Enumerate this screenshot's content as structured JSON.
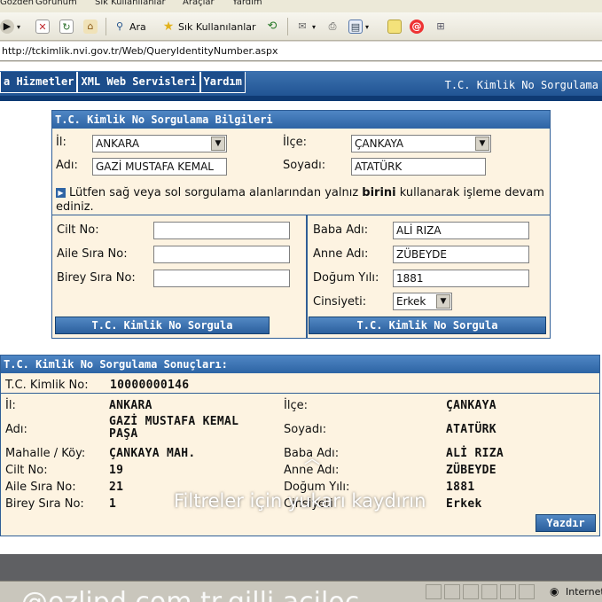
{
  "browser": {
    "menu": [
      "Gözden",
      "Görünüm",
      "Sık Kullanılanlar",
      "Araçlar",
      "Yardım"
    ],
    "search_label": "Ara",
    "favorites_label": "Sık Kullanılanlar",
    "address": "http://tckimlik.nvi.gov.tr/Web/QueryIdentityNumber.aspx",
    "status_internet": "Internet"
  },
  "nav": {
    "links": [
      "a Hizmetler",
      "XML Web Servisleri",
      "Yardım"
    ],
    "title": "T.C. Kimlik No Sorgulama"
  },
  "query_form": {
    "title": "T.C. Kimlik No Sorgulama Bilgileri",
    "il_label": "İl:",
    "il_value": "ANKARA",
    "ilce_label": "İlçe:",
    "ilce_value": "ÇANKAYA",
    "adi_label": "Adı:",
    "adi_value": "GAZİ MUSTAFA KEMAL",
    "soyadi_label": "Soyadı:",
    "soyadi_value": "ATATÜRK",
    "info_pre": "Lütfen sağ veya sol sorgulama alanlarından yalnız ",
    "info_bold": "birini",
    "info_post": " kullanarak işleme devam ediniz.",
    "left": {
      "cilt_label": "Cilt No:",
      "cilt_value": "",
      "aile_label": "Aile Sıra No:",
      "aile_value": "",
      "birey_label": "Birey Sıra No:",
      "birey_value": "",
      "button": "T.C. Kimlik No Sorgula"
    },
    "right": {
      "baba_label": "Baba Adı:",
      "baba_value": "ALİ RIZA",
      "anne_label": "Anne Adı:",
      "anne_value": "ZÜBEYDE",
      "dogum_label": "Doğum Yılı:",
      "dogum_value": "1881",
      "cins_label": "Cinsiyeti:",
      "cins_value": "Erkek",
      "button": "T.C. Kimlik No Sorgula"
    }
  },
  "results": {
    "title": "T.C. Kimlik No Sorgulama Sonuçları:",
    "tc_label": "T.C. Kimlik No:",
    "tc_value": "10000000146",
    "il_label": "İl:",
    "il_value": "ANKARA",
    "ilce_label": "İlçe:",
    "ilce_value": "ÇANKAYA",
    "adi_label": "Adı:",
    "adi_value": "GAZİ MUSTAFA KEMAL PAŞA",
    "soyadi_label": "Soyadı:",
    "soyadi_value": "ATATÜRK",
    "mahalle_label": "Mahalle / Köy:",
    "mahalle_value": "ÇANKAYA MAH.",
    "baba_label": "Baba Adı:",
    "baba_value": "ALİ RIZA",
    "cilt_label": "Cilt No:",
    "cilt_value": "19",
    "anne_label": "Anne Adı:",
    "anne_value": "ZÜBEYDE",
    "aile_label": "Aile Sıra No:",
    "aile_value": "21",
    "dogum_label": "Doğum Yılı:",
    "dogum_value": "1881",
    "birey_label": "Birey Sıra No:",
    "birey_value": "1",
    "cins_label": "Cinsiyeti:",
    "cins_value": "Erkek",
    "print_button": "Yazdır"
  },
  "overlay_text": "Filtreler için yukarı kaydırın",
  "watermark": "@ozlipd.com.tr.gilli.aciloc"
}
